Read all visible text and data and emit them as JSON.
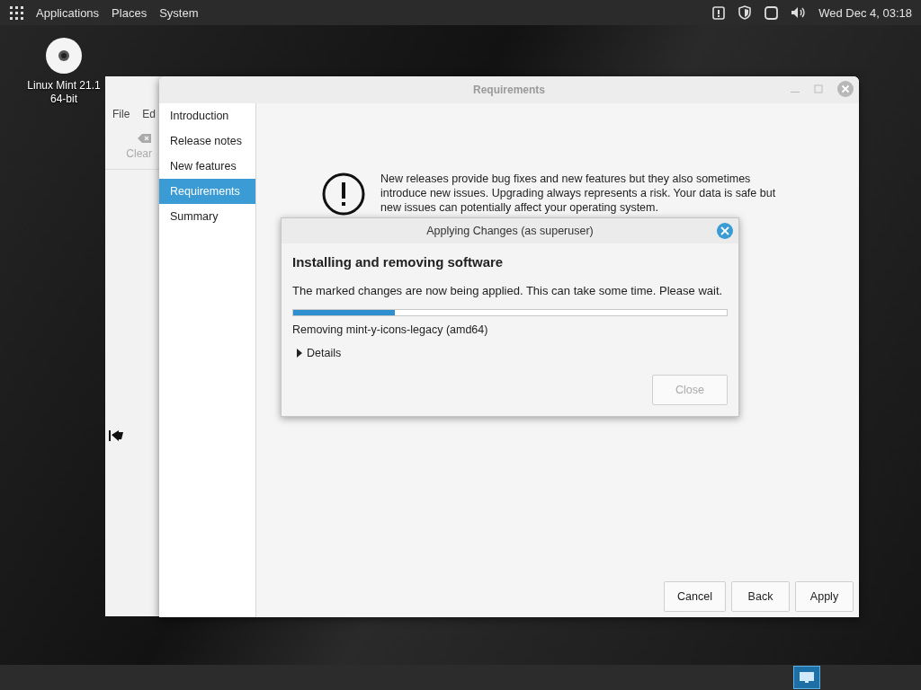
{
  "top_panel": {
    "menus": [
      "Applications",
      "Places",
      "System"
    ],
    "clock": "Wed Dec 4, 03:18"
  },
  "desktop_icons": [
    {
      "lines": [
        "Linux Mint 21.1",
        "64-bit"
      ]
    }
  ],
  "back_window": {
    "menus": [
      "File",
      "Ed"
    ],
    "toolbar": [
      {
        "label": "Clear",
        "disabled": true
      }
    ]
  },
  "window": {
    "title": "Requirements",
    "sidebar": {
      "items": [
        {
          "label": "Introduction",
          "selected": false
        },
        {
          "label": "Release notes",
          "selected": false
        },
        {
          "label": "New features",
          "selected": false
        },
        {
          "label": "Requirements",
          "selected": true
        },
        {
          "label": "Summary",
          "selected": false
        }
      ]
    },
    "notice": "New releases provide bug fixes and new features but they also sometimes introduce new issues. Upgrading always represents a risk. Your data is safe but new issues can potentially affect your operating system.",
    "buttons": [
      "Cancel",
      "Back",
      "Apply"
    ]
  },
  "dialog": {
    "title": "Applying Changes (as superuser)",
    "heading": "Installing and removing software",
    "message": "The marked changes are now being applied. This can take some time. Please wait.",
    "progress": {
      "level": 0.235
    },
    "status": "Removing mint-y-icons-legacy (amd64)",
    "details": {
      "label": "Details",
      "expanded": false
    },
    "close_button": {
      "label": "Close",
      "disabled": true
    }
  }
}
